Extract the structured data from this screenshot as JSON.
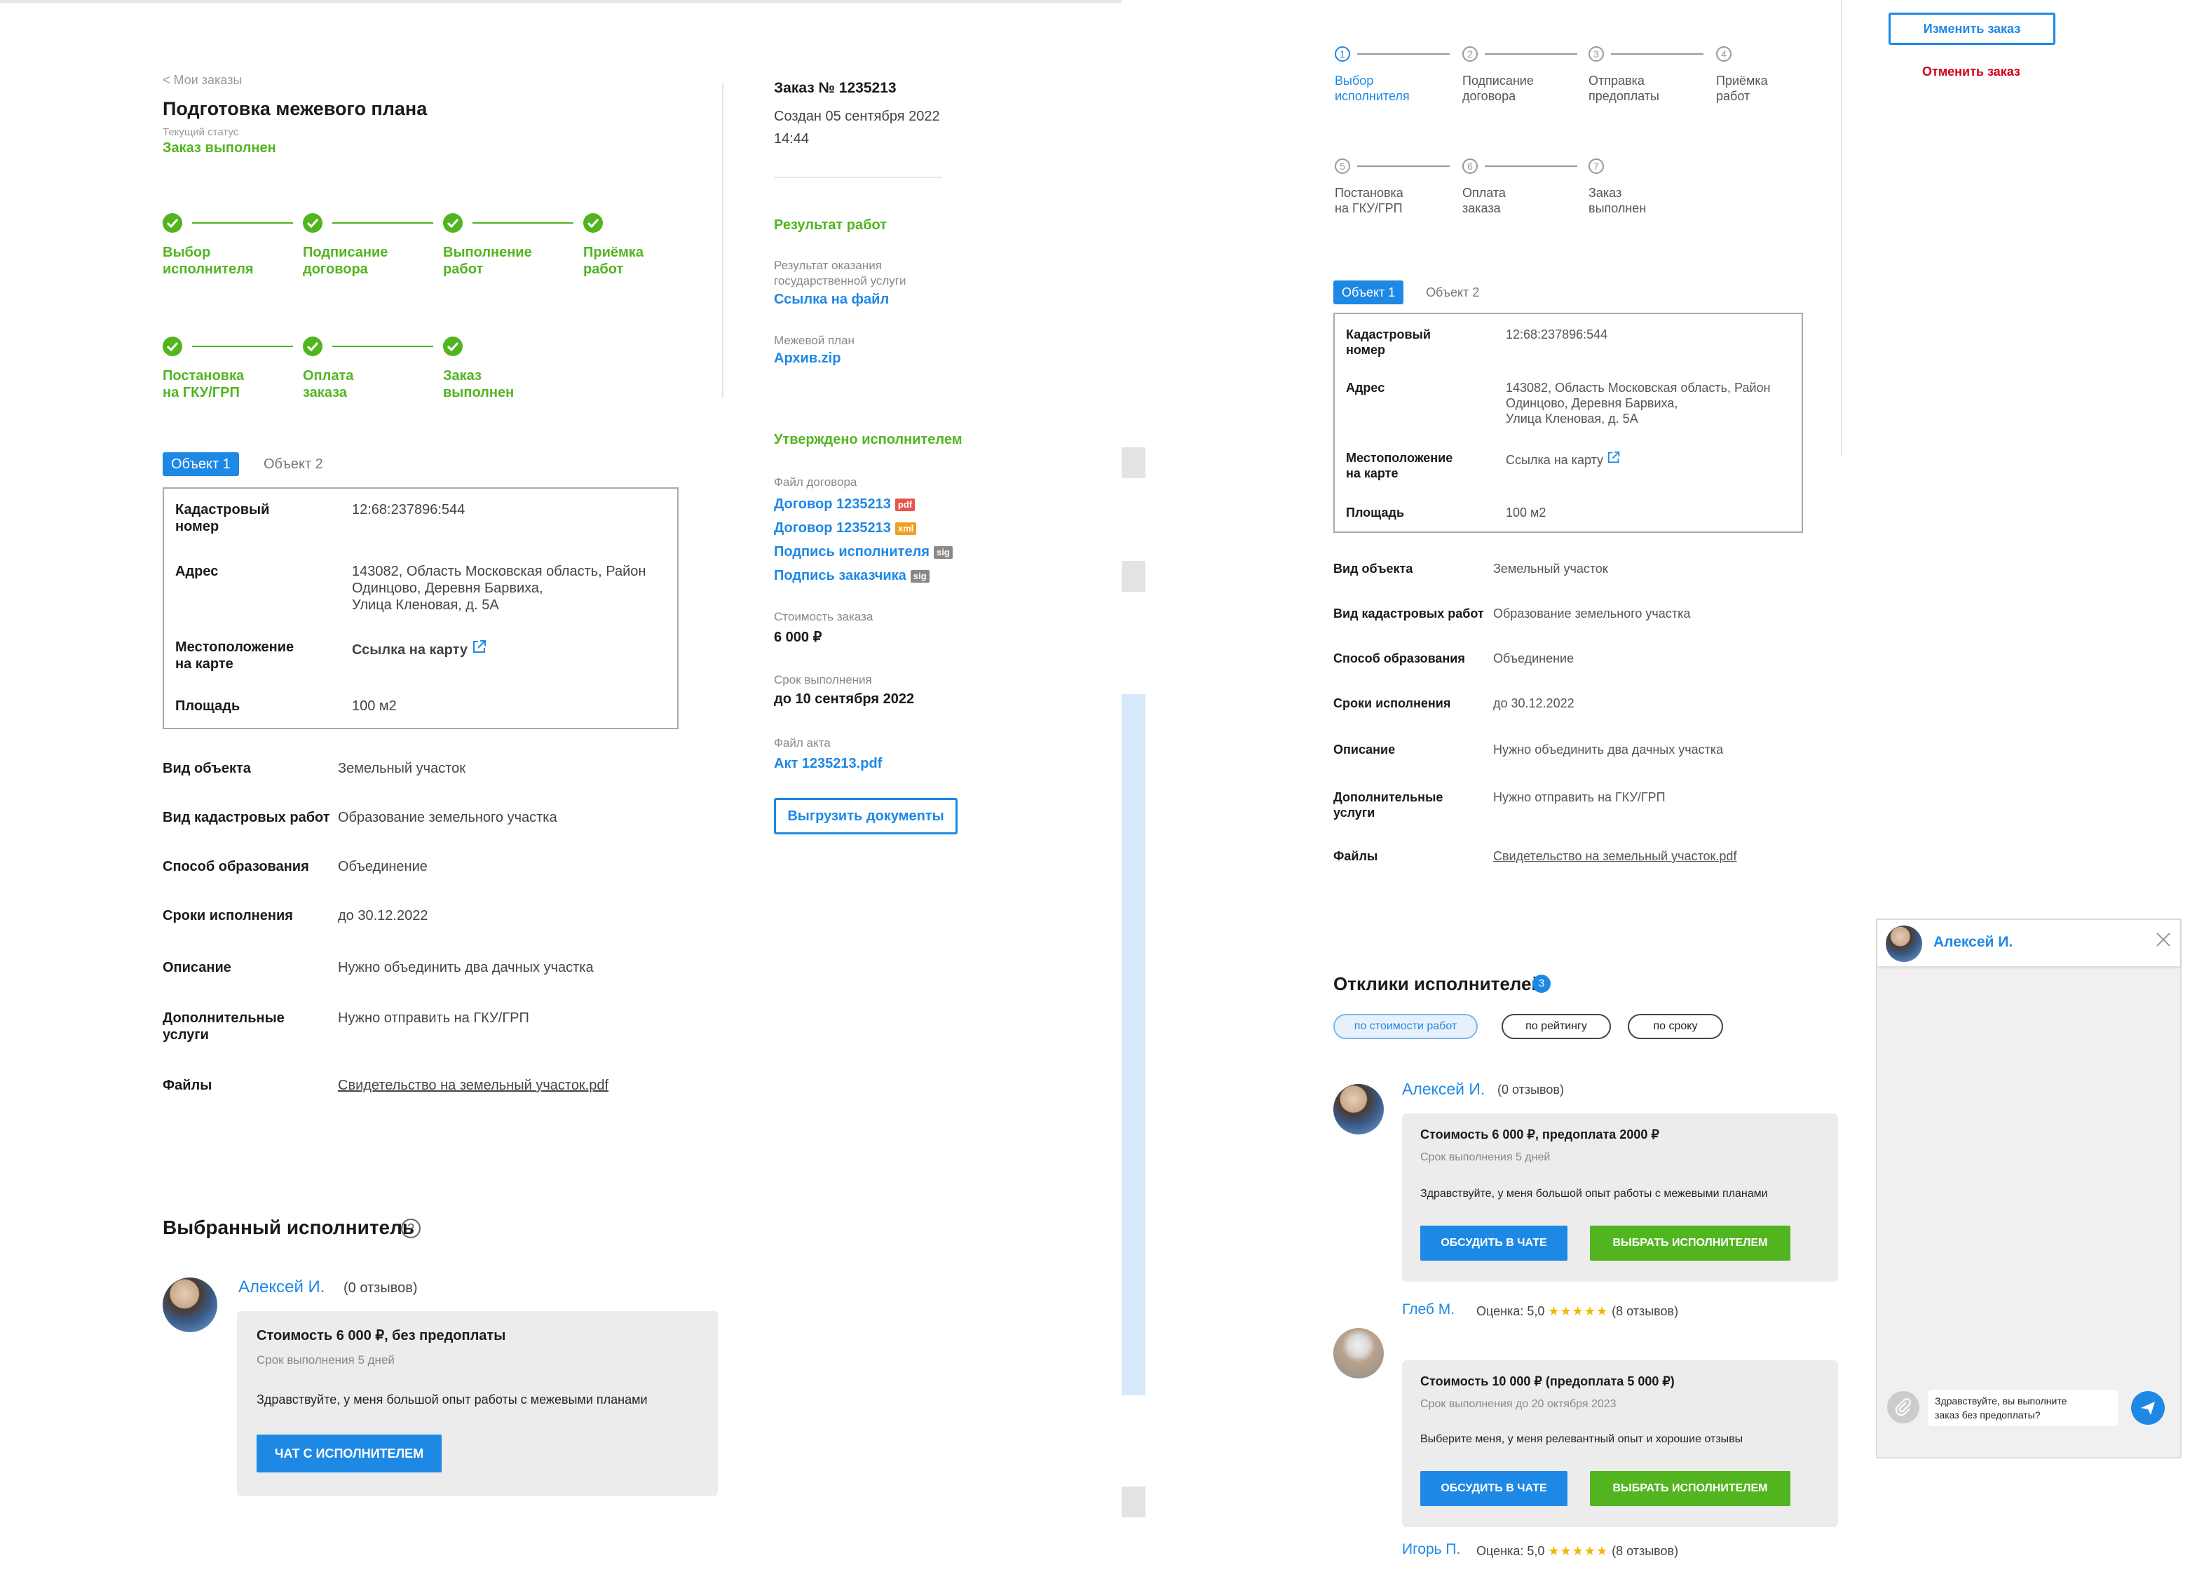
{
  "left": {
    "back": "< Мои заказы",
    "title": "Подготовка межевого плана",
    "status_label": "Текущий статус",
    "status": "Заказ выполнен",
    "steps": [
      "Выбор\nисполнителя",
      "Подписание\nдоговора",
      "Выполнение\nработ",
      "Приёмка\nработ",
      "Постановка\nна ГКУ/ГРП",
      "Оплата\nзаказа",
      "Заказ\nвыполнен"
    ],
    "tabs": [
      "Объект 1",
      "Объект 2"
    ],
    "object": [
      {
        "k": "Кадастровый\nномер",
        "v": "12:68:237896:544"
      },
      {
        "k": "Адрес",
        "v": "143082, Область Московская область, Район\nОдинцово, Деревня Барвиха,\nУлица Кленовая, д. 5А"
      },
      {
        "k": "Местоположение\nна карте",
        "v": "Ссылка на карту"
      },
      {
        "k": "Площадь",
        "v": "100 м2"
      }
    ],
    "details": [
      {
        "k": "Вид объекта",
        "v": "Земельный участок"
      },
      {
        "k": "Вид кадастровых работ",
        "v": "Образование земельного участка"
      },
      {
        "k": "Способ образования",
        "v": "Объединение"
      },
      {
        "k": "Сроки исполнения",
        "v": "до 30.12.2022"
      },
      {
        "k": "Описание",
        "v": "Нужно объединить два дачных участка"
      },
      {
        "k": "Дополнительные\nуслуги",
        "v": "Нужно отправить на ГКУ/ГРП"
      },
      {
        "k": "Файлы",
        "v": "Свидетельство на земельный участок.pdf"
      }
    ],
    "selected_title": "Выбранный исполнитель",
    "selected_help": "?",
    "executor": {
      "name": "Алексей И.",
      "reviews": "(0 отзывов)",
      "price": "Стоимость 6 000 ₽, без предоплаты",
      "term": "Срок выполнения 5 дней",
      "message": "Здравствуйте, у меня большой опыт работы с межевыми планами",
      "chat": "ЧАТ С ИСПОЛНИТЕЛЕМ"
    }
  },
  "sidebar": {
    "order_no": "Заказ № 1235213",
    "created": "Создан 05 сентября 2022\n14:44",
    "result_title": "Результат работ",
    "result_label": "Результат оказания\nгосударственной услуги",
    "result_link": "Ссылка на файл",
    "plan_label": "Межевой план",
    "plan_link": "Архив.zip",
    "approved": "Утверждено исполнителем",
    "contract_label": "Файл договора",
    "files": [
      {
        "name": "Договор 1235213",
        "tag": "pdf",
        "color": "#e8534a"
      },
      {
        "name": "Договор 1235213",
        "tag": "xml",
        "color": "#f0a020"
      },
      {
        "name": "Подпись исполнителя",
        "tag": "sig",
        "color": "#888888"
      },
      {
        "name": "Подпись заказчика",
        "tag": "sig",
        "color": "#888888"
      }
    ],
    "cost_label": "Стоимость заказа",
    "cost": "6 000 ₽",
    "term_label": "Срок выполнения",
    "term": "до 10 сентября 2022",
    "act_label": "Файл акта",
    "act": "Акт 1235213.pdf",
    "export": "Выгрузить докумеnты"
  },
  "right": {
    "steps": [
      "Выбор\nисполнителя",
      "Подписание\nдоговора",
      "Отправка\nпредоплаты",
      "Приёмка\nработ",
      "Постановка\nна ГКУ/ГРП",
      "Оплата\nзаказа",
      "Заказ\nвыполнен"
    ],
    "step_nums": [
      "1",
      "2",
      "3",
      "4",
      "5",
      "6",
      "7"
    ],
    "tabs": [
      "Объект 1",
      "Объект 2"
    ],
    "responses_title": "Отклики исполнителей",
    "responses_count": "3",
    "sort": [
      "по стоимости  работ",
      "по рейтингу",
      "по сроку"
    ],
    "offers": [
      {
        "name": "Алексей И.",
        "meta": "(0 отзывов)",
        "price": "Стоимость 6 000 ₽, предоплата 2000 ₽",
        "term": "Срок выполнения 5 дней",
        "msg": "Здравствуйте, у меня большой опыт работы с межевыми планами",
        "discuss": "ОБСУДИТЬ В ЧАТЕ",
        "choose": "ВЫБРАТЬ ИСПОЛНИТЕЛЕМ"
      },
      {
        "name": "Глеб М.",
        "meta": "Оценка: 5,0",
        "stars": "★★★★★",
        "reviews": "(8 отзывов)",
        "price": "Стоимость  10 000 ₽ (предоплата 5 000 ₽)",
        "term": "Срок выполнения до 20 октября 2023",
        "msg": "Выберите меня, у меня релевантный опыт и хорошие отзывы",
        "discuss": "ОБСУДИТЬ В ЧАТЕ",
        "choose": "ВЫБРАТЬ ИСПОЛНИТЕЛЕМ"
      },
      {
        "name": "Игорь П.",
        "meta": "Оценка: 5,0",
        "stars": "★★★★★",
        "reviews": "(8 отзывов)"
      }
    ],
    "change": "Изменить заказ",
    "cancel": "Отменить заказ",
    "chat": {
      "name": "Алексей И.",
      "message": "Здравствуйте, вы выполните\nзаказ без предоплаты?"
    }
  }
}
